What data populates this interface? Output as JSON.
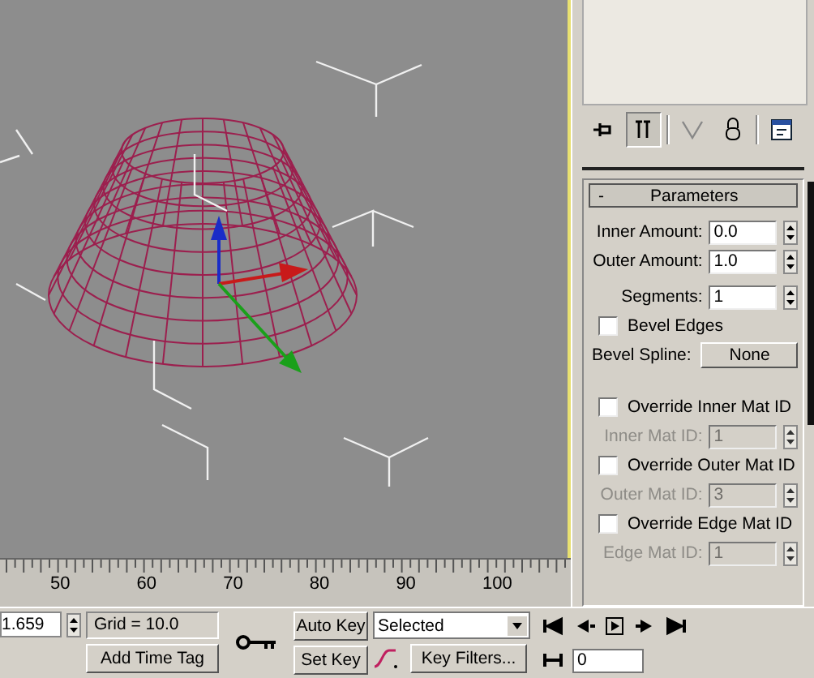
{
  "viewport": {
    "active": true
  },
  "command_panel": {
    "toolbar": [
      {
        "kind": "pin",
        "selected": false
      },
      {
        "kind": "stack",
        "selected": true
      },
      {
        "kind": "funnel",
        "selected": false
      },
      {
        "kind": "lock",
        "selected": false
      },
      {
        "kind": "config",
        "selected": false
      }
    ],
    "rollout": {
      "toggle": "-",
      "title": "Parameters",
      "rows": [
        {
          "kind": "spinner",
          "label": "Inner Amount:",
          "value": "0.0",
          "disabled": false
        },
        {
          "kind": "spinner",
          "label": "Outer Amount:",
          "value": "1.0",
          "disabled": false
        },
        {
          "kind": "spinner",
          "label": "Segments:",
          "value": "1",
          "disabled": false,
          "separated": true
        },
        {
          "kind": "checkbox",
          "label": "Bevel Edges",
          "checked": false
        },
        {
          "kind": "button",
          "label": "Bevel Spline:",
          "value": "None"
        },
        {
          "kind": "checkbox",
          "label": "Override Inner Mat ID",
          "checked": false,
          "separated": true
        },
        {
          "kind": "spinner",
          "label": "Inner Mat ID:",
          "value": "1",
          "disabled": true
        },
        {
          "kind": "checkbox",
          "label": "Override Outer Mat ID",
          "checked": false
        },
        {
          "kind": "spinner",
          "label": "Outer Mat ID:",
          "value": "3",
          "disabled": true
        },
        {
          "kind": "checkbox",
          "label": "Override Edge Mat ID",
          "checked": false
        },
        {
          "kind": "spinner",
          "label": "Edge Mat ID:",
          "value": "1",
          "disabled": true
        }
      ]
    }
  },
  "timeline": {
    "ticks": [
      "50",
      "60",
      "70",
      "80",
      "90",
      "100"
    ]
  },
  "status_bar": {
    "coordinate": "1.659",
    "grid": "Grid = 10.0",
    "add_time_tag": "Add Time Tag",
    "auto_key": "Auto Key",
    "set_key": "Set Key",
    "key_mode": "Selected",
    "key_filters": "Key Filters...",
    "frame": "0"
  }
}
